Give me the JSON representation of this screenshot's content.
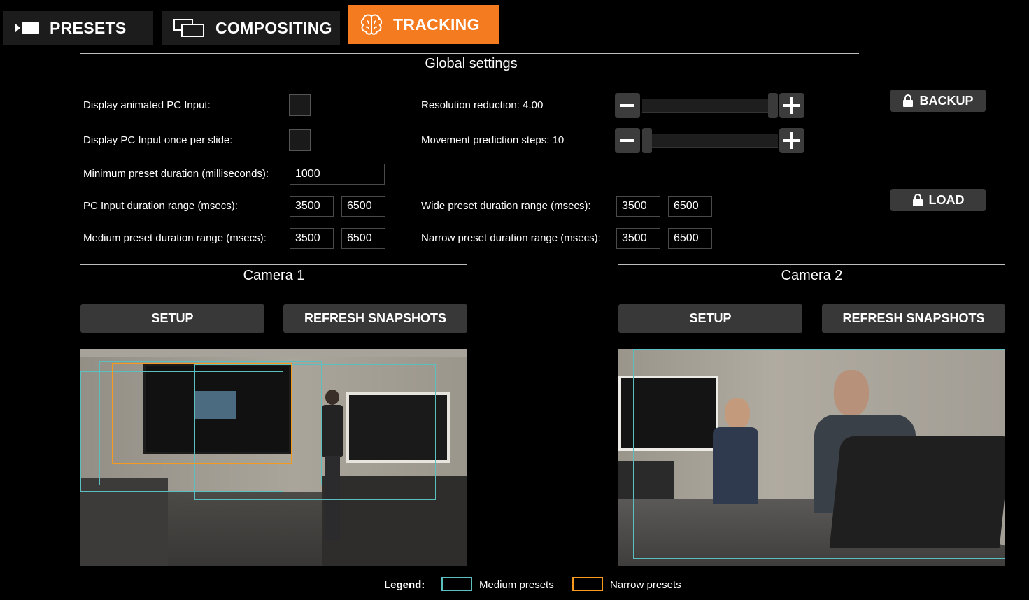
{
  "colors": {
    "accent": "#f47b20",
    "medium": "#5bbfc0",
    "narrow": "#f49a1e"
  },
  "tabs": [
    {
      "label": "PRESETS",
      "icon": "camera-icon"
    },
    {
      "label": "COMPOSITING",
      "icon": "compositing-icon"
    },
    {
      "label": "TRACKING",
      "icon": "brain-icon",
      "active": true
    }
  ],
  "global": {
    "title": "Global settings",
    "display_animated_label": "Display animated PC Input:",
    "display_once_label": "Display PC Input once per slide:",
    "min_duration_label": "Minimum preset duration (milliseconds):",
    "min_duration_value": "1000",
    "pc_range_label": "PC Input duration range (msecs):",
    "pc_range_min": "3500",
    "pc_range_max": "6500",
    "medium_range_label": "Medium preset duration range (msecs):",
    "medium_range_min": "3500",
    "medium_range_max": "6500",
    "resolution_label": "Resolution reduction: 4.00",
    "resolution_level": 1.0,
    "movement_label": "Movement prediction steps: 10",
    "movement_level": 0.0,
    "wide_range_label": "Wide preset duration range (msecs):",
    "wide_range_min": "3500",
    "wide_range_max": "6500",
    "narrow_range_label": "Narrow preset duration range (msecs):",
    "narrow_range_min": "3500",
    "narrow_range_max": "6500",
    "backup_label": "BACKUP",
    "load_label": "LOAD"
  },
  "camera1": {
    "title": "Camera 1",
    "setup_label": "SETUP",
    "refresh_label": "REFRESH SNAPSHOTS"
  },
  "camera2": {
    "title": "Camera 2",
    "setup_label": "SETUP",
    "refresh_label": "REFRESH SNAPSHOTS"
  },
  "legend": {
    "label": "Legend:",
    "medium_label": "Medium presets",
    "narrow_label": "Narrow presets"
  }
}
